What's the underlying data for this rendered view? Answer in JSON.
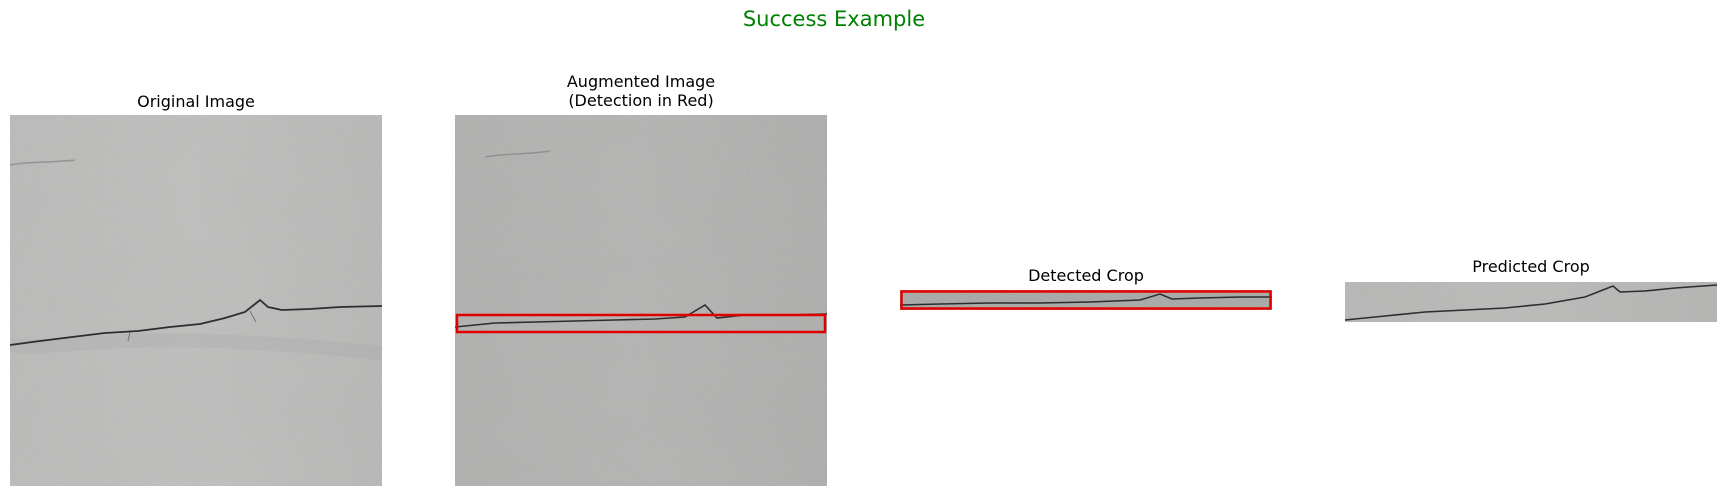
{
  "figure": {
    "title": "Success Example",
    "title_color": "#008000",
    "box_color": "#e00000"
  },
  "panels": [
    {
      "title_lines": [
        "Original Image"
      ]
    },
    {
      "title_lines": [
        "Augmented Image",
        "(Detection in Red)"
      ]
    },
    {
      "title_lines": [
        "Detected Crop"
      ]
    },
    {
      "title_lines": [
        "Predicted Crop"
      ]
    }
  ],
  "icons": {
    "photo_1": "cracked-wall-photo-icon",
    "photo_2": "cracked-wall-photo-with-detection-icon",
    "photo_3": "detected-crop-photo-icon",
    "photo_4": "predicted-crop-photo-icon"
  }
}
